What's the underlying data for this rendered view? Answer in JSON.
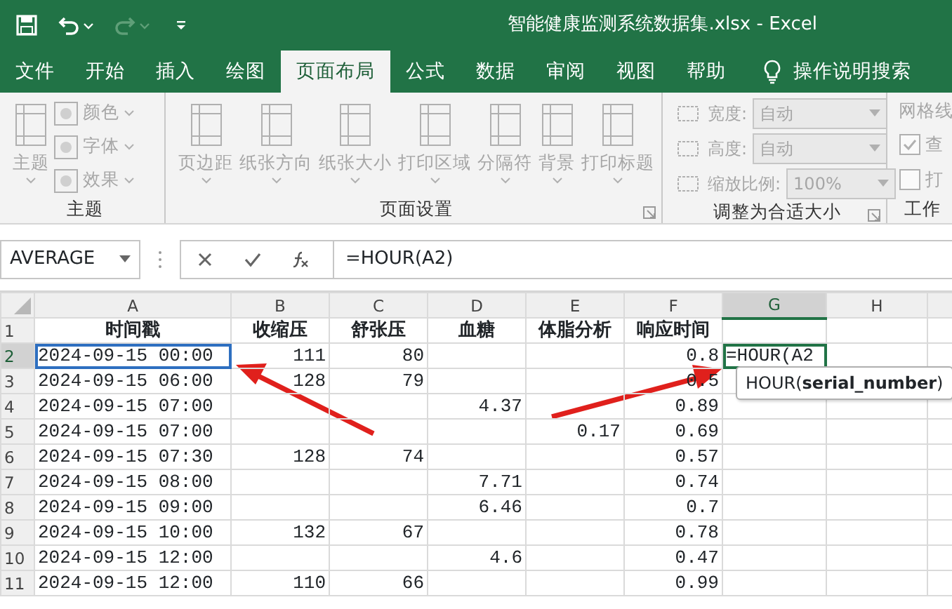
{
  "title_bar": {
    "title": "智能健康监测系统数据集.xlsx  -  Excel",
    "redo_disabled": true
  },
  "tabs": [
    {
      "label": "文件",
      "selected": false
    },
    {
      "label": "开始",
      "selected": false
    },
    {
      "label": "插入",
      "selected": false
    },
    {
      "label": "绘图",
      "selected": false
    },
    {
      "label": "页面布局",
      "selected": true
    },
    {
      "label": "公式",
      "selected": false
    },
    {
      "label": "数据",
      "selected": false
    },
    {
      "label": "审阅",
      "selected": false
    },
    {
      "label": "视图",
      "selected": false
    },
    {
      "label": "帮助",
      "selected": false
    }
  ],
  "tell_me": {
    "label": "操作说明搜索"
  },
  "ribbon": {
    "groups": [
      {
        "label": "主题",
        "launcher": false,
        "items": [
          {
            "kind": "large",
            "label": "主题",
            "disabled": true
          },
          {
            "kind": "small",
            "label": "颜色",
            "disabled": true
          },
          {
            "kind": "small",
            "label": "字体",
            "disabled": true
          },
          {
            "kind": "small",
            "label": "效果",
            "disabled": true
          }
        ]
      },
      {
        "label": "页面设置",
        "launcher": true,
        "items": [
          {
            "kind": "large",
            "label": "页边距",
            "disabled": true
          },
          {
            "kind": "large",
            "label": "纸张方向",
            "disabled": true
          },
          {
            "kind": "large",
            "label": "纸张大小",
            "disabled": true
          },
          {
            "kind": "large",
            "label": "打印区域",
            "disabled": true
          },
          {
            "kind": "large",
            "label": "分隔符",
            "disabled": true
          },
          {
            "kind": "large",
            "label": "背景",
            "disabled": true
          },
          {
            "kind": "large",
            "label": "打印标题",
            "disabled": true
          }
        ]
      },
      {
        "label": "调整为合适大小",
        "launcher": true,
        "items": [
          {
            "kind": "field",
            "label": "宽度:",
            "value": "自动",
            "disabled": true
          },
          {
            "kind": "field",
            "label": "高度:",
            "value": "自动",
            "disabled": true
          },
          {
            "kind": "field",
            "label": "缩放比例:",
            "value": "100%",
            "disabled": true
          }
        ]
      },
      {
        "label": "工作",
        "launcher": false,
        "items": [
          {
            "kind": "heading",
            "label": "网格线",
            "disabled": true
          },
          {
            "kind": "check",
            "label": "查",
            "checked": true,
            "disabled": true
          },
          {
            "kind": "check",
            "label": "打",
            "checked": false,
            "disabled": true
          }
        ]
      }
    ]
  },
  "formula_bar": {
    "name_box": "AVERAGE",
    "formula": "=HOUR(A2)"
  },
  "sheet": {
    "columns": [
      {
        "label": "A",
        "selected": false
      },
      {
        "label": "B",
        "selected": false
      },
      {
        "label": "C",
        "selected": false
      },
      {
        "label": "D",
        "selected": false
      },
      {
        "label": "E",
        "selected": false
      },
      {
        "label": "F",
        "selected": false
      },
      {
        "label": "G",
        "selected": true
      },
      {
        "label": "H",
        "selected": false
      }
    ],
    "rows": [
      {
        "number": "1",
        "selected": false,
        "kind": "header",
        "cells": [
          "时间戳",
          "收缩压",
          "舒张压",
          "血糖",
          "体脂分析",
          "响应时间",
          null,
          null
        ]
      },
      {
        "number": "2",
        "selected": true,
        "kind": "data",
        "cells": [
          {
            "text": "2024-09-15 00:00",
            "referenced": true
          },
          "111",
          "80",
          null,
          null,
          "0.8",
          {
            "text": "=HOUR(A2",
            "editing": true
          },
          null
        ]
      },
      {
        "number": "3",
        "selected": false,
        "kind": "data",
        "cells": [
          "2024-09-15 06:00",
          "128",
          "79",
          null,
          null,
          "0.5",
          null,
          null
        ]
      },
      {
        "number": "4",
        "selected": false,
        "kind": "data",
        "cells": [
          "2024-09-15 07:00",
          null,
          null,
          "4.37",
          null,
          "0.89",
          null,
          null
        ]
      },
      {
        "number": "5",
        "selected": false,
        "kind": "data",
        "cells": [
          "2024-09-15 07:00",
          null,
          null,
          null,
          "0.17",
          "0.69",
          null,
          null
        ]
      },
      {
        "number": "6",
        "selected": false,
        "kind": "data",
        "cells": [
          "2024-09-15 07:30",
          "128",
          "74",
          null,
          null,
          "0.57",
          null,
          null
        ]
      },
      {
        "number": "7",
        "selected": false,
        "kind": "data",
        "cells": [
          "2024-09-15 08:00",
          null,
          null,
          "7.71",
          null,
          "0.74",
          null,
          null
        ]
      },
      {
        "number": "8",
        "selected": false,
        "kind": "data",
        "cells": [
          "2024-09-15 09:00",
          null,
          null,
          "6.46",
          null,
          "0.7",
          null,
          null
        ]
      },
      {
        "number": "9",
        "selected": false,
        "kind": "data",
        "cells": [
          "2024-09-15 10:00",
          "132",
          "67",
          null,
          null,
          "0.78",
          null,
          null
        ]
      },
      {
        "number": "10",
        "selected": false,
        "kind": "data",
        "cells": [
          "2024-09-15 12:00",
          null,
          null,
          "4.6",
          null,
          "0.47",
          null,
          null
        ]
      },
      {
        "number": "11",
        "selected": false,
        "kind": "data",
        "cells": [
          "2024-09-15 12:00",
          "110",
          "66",
          null,
          null,
          "0.99",
          null,
          null
        ]
      }
    ],
    "tooltip": "HOUR(**serial_number**)"
  }
}
